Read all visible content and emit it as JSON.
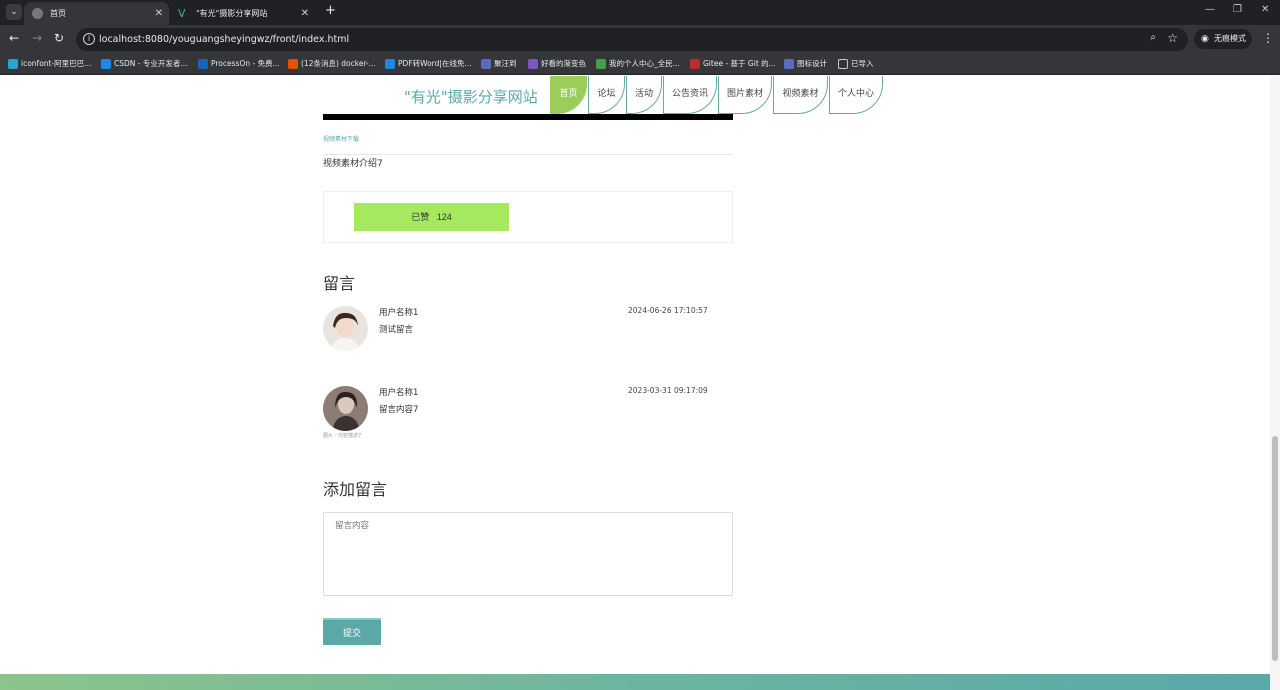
{
  "browser": {
    "tabs": [
      {
        "title": "首页",
        "active": true
      },
      {
        "title": "\"有光\"摄影分享网站",
        "active": false
      }
    ],
    "url": "localhost:8080/youguangsheyingwz/front/index.html",
    "incognito_label": "无痕模式",
    "bookmarks": [
      {
        "label": "iconfont-阿里巴巴...",
        "icon_color": "#2aa5c7"
      },
      {
        "label": "CSDN - 专业开发者...",
        "icon_color": "#1e88e5"
      },
      {
        "label": "ProcessOn - 免费...",
        "icon_color": "#1565c0"
      },
      {
        "label": "(12条消息) docker-...",
        "icon_color": "#e65100"
      },
      {
        "label": "PDF转Word|在线免...",
        "icon_color": "#1e88e5"
      },
      {
        "label": "聚汪到",
        "icon_color": "#5c6bc0"
      },
      {
        "label": "好看的渐变色",
        "icon_color": "#7e57c2"
      },
      {
        "label": "我的个人中心_全民...",
        "icon_color": "#43a047"
      },
      {
        "label": "Gitee - 基于 Git 的...",
        "icon_color": "#c62828"
      },
      {
        "label": "图标设计",
        "icon_color": "#5c6bc0"
      },
      {
        "label": "已导入",
        "icon_color": "#9e9e9e"
      }
    ]
  },
  "site": {
    "title": "\"有光\"摄影分享网站",
    "nav": [
      "首页",
      "论坛",
      "活动",
      "公告资讯",
      "图片素材",
      "视频素材",
      "个人中心"
    ],
    "active_nav": "首页"
  },
  "detail": {
    "download_link": "视频素材下载",
    "intro": "视频素材介绍7",
    "like_label": "已赞",
    "like_count": "124"
  },
  "comments_section": {
    "title": "留言",
    "items": [
      {
        "user": "用户名称1",
        "text": "测试留言",
        "time": "2024-06-26 17:10:57",
        "caption": ""
      },
      {
        "user": "用户名称1",
        "text": "留言内容7",
        "time": "2023-03-31 09:17:09",
        "caption": "图片 - 内容描述7"
      }
    ]
  },
  "add_comment": {
    "title": "添加留言",
    "placeholder": "留言内容",
    "submit_label": "提交"
  },
  "colors": {
    "accent": "#5aa8a8",
    "nav_active": "#9ccd5a",
    "like_button": "#a5e95e"
  }
}
